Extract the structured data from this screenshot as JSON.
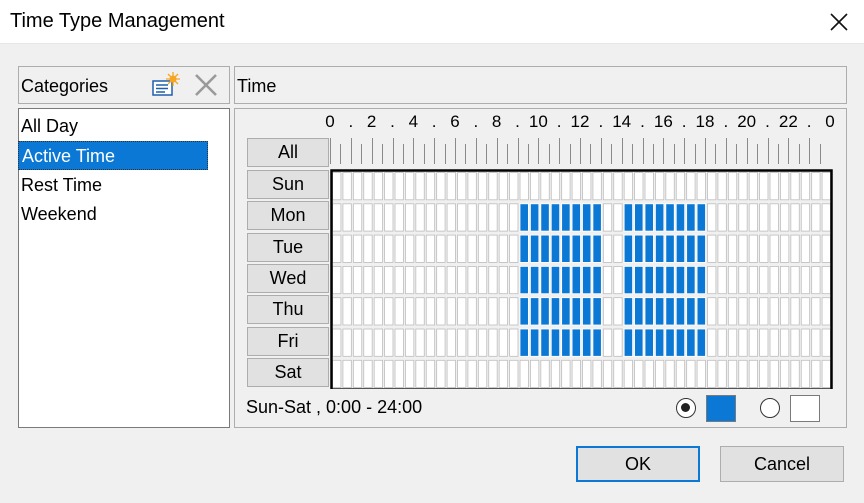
{
  "window": {
    "title": "Time Type Management",
    "close_icon": "close-icon"
  },
  "categories": {
    "title": "Categories",
    "add_icon": "new-category-icon",
    "delete_icon": "delete-icon",
    "items": [
      {
        "label": "All Day",
        "selected": false
      },
      {
        "label": "Active Time",
        "selected": true
      },
      {
        "label": "Rest Time",
        "selected": false
      },
      {
        "label": "Weekend",
        "selected": false
      }
    ]
  },
  "time": {
    "title": "Time",
    "hour_labels": [
      "0",
      ".",
      "2",
      ".",
      "4",
      ".",
      "6",
      ".",
      "8",
      ".",
      "10",
      ".",
      "12",
      ".",
      "14",
      ".",
      "16",
      ".",
      "18",
      ".",
      "20",
      ".",
      "22",
      ".",
      "0"
    ],
    "all_label": "All",
    "days": [
      "Sun",
      "Mon",
      "Tue",
      "Wed",
      "Thu",
      "Fri",
      "Sat"
    ],
    "slots_per_day": 48,
    "active_days": [
      "Mon",
      "Tue",
      "Wed",
      "Thu",
      "Fri"
    ],
    "active_ranges_hours": [
      [
        9,
        13
      ],
      [
        14,
        18
      ]
    ],
    "summary": "Sun-Sat , 0:00 - 24:00",
    "fill_color": "#0a78d4",
    "empty_color": "#ffffff",
    "mode_fill_selected": true
  },
  "buttons": {
    "ok": "OK",
    "cancel": "Cancel"
  }
}
